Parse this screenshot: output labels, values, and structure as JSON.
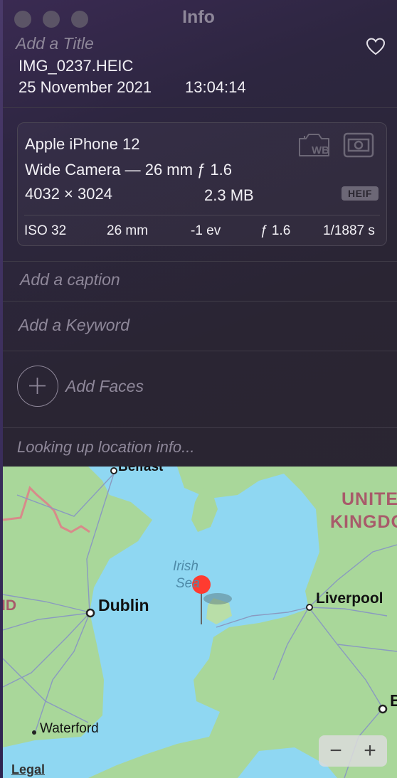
{
  "window": {
    "title": "Info"
  },
  "photo": {
    "title_placeholder": "Add a Title",
    "filename": "IMG_0237.HEIC",
    "date": "25 November 2021",
    "time": "13:04:14"
  },
  "camera": {
    "device": "Apple iPhone 12",
    "lens": "Wide Camera — 26 mm ƒ 1.6",
    "resolution": "4032 × 3024",
    "size": "2.3 MB",
    "format": "HEIF",
    "wb_label": "WB",
    "exif": {
      "iso": "ISO 32",
      "focal": "26 mm",
      "exposure": "-1 ev",
      "aperture": "ƒ 1.6",
      "shutter": "1/1887 s"
    }
  },
  "fields": {
    "caption_placeholder": "Add a caption",
    "keyword_placeholder": "Add a Keyword",
    "faces_label": "Add Faces",
    "location_status": "Looking up location info..."
  },
  "map": {
    "labels": {
      "belfast": "Belfast",
      "uk_line1": "UNITE",
      "uk_line2": "KINGDO",
      "irish_sea_1": "Irish",
      "irish_sea_2": "Sea",
      "dublin": "Dublin",
      "liverpool": "Liverpool",
      "waterford": "Waterford",
      "ireland_fragment": "ID",
      "birmingham_fragment": "B"
    },
    "legal": "Legal",
    "zoom_out": "−",
    "zoom_in": "+"
  },
  "colors": {
    "pin": "#ff3b30",
    "sea": "#8fd7f2",
    "land": "#a9d79a"
  }
}
